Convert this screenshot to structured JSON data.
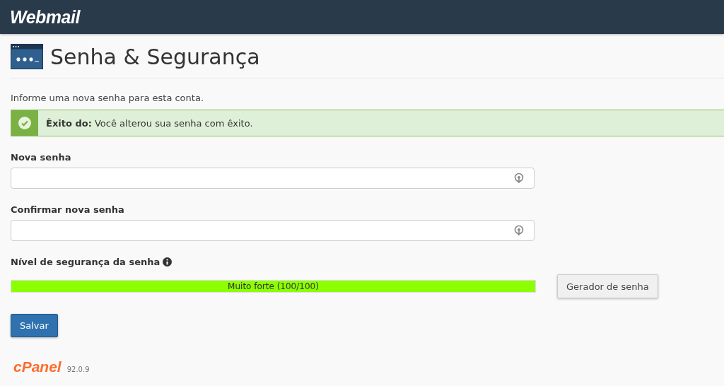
{
  "header": {
    "logo": "Webmail"
  },
  "page": {
    "title": "Senha & Segurança",
    "intro": "Informe uma nova senha para esta conta."
  },
  "alert": {
    "kind": "success",
    "message": "**Êxito do:** Você alterou sua senha com êxito."
  },
  "fields": [
    {
      "label": "Nova senha"
    },
    {
      "label": "Confirmar nova senha"
    }
  ],
  "strength": {
    "label": "Nível de segurança da senha",
    "level": 1,
    "reading": "Muito forte (100/100)",
    "generator_button": "Gerador de senha"
  },
  "save_button": "Salvar",
  "footer": {
    "logo": "cPanel",
    "version": "92.0.9"
  }
}
